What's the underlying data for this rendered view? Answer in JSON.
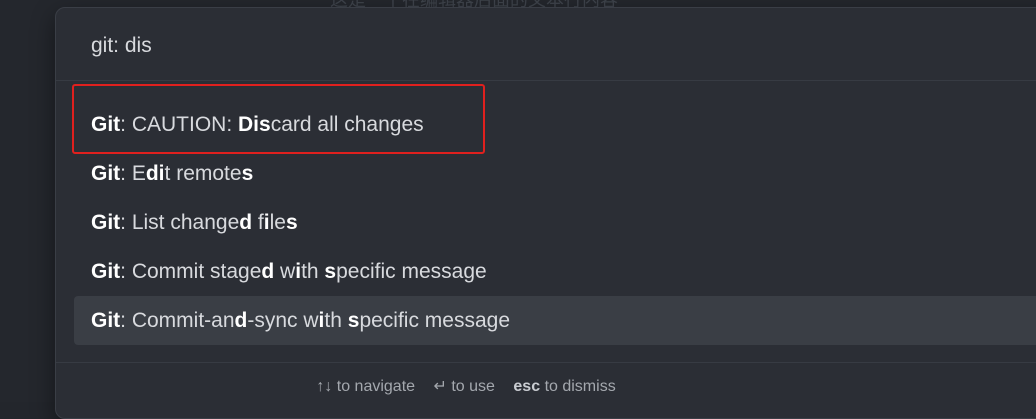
{
  "background": {
    "ghost_text": "这是一个在编辑器后面的文本行内容"
  },
  "search": {
    "value": "git: dis",
    "placeholder": ""
  },
  "results": [
    {
      "segments": [
        {
          "t": "Git",
          "b": true
        },
        {
          "t": ": CAUTION: ",
          "b": false
        },
        {
          "t": "Dis",
          "b": true
        },
        {
          "t": "card all changes",
          "b": false
        }
      ]
    },
    {
      "segments": [
        {
          "t": "Git",
          "b": true
        },
        {
          "t": ": E",
          "b": false
        },
        {
          "t": "di",
          "b": true
        },
        {
          "t": "t remote",
          "b": false
        },
        {
          "t": "s",
          "b": true
        }
      ]
    },
    {
      "segments": [
        {
          "t": "Git",
          "b": true
        },
        {
          "t": ": List change",
          "b": false
        },
        {
          "t": "d",
          "b": true
        },
        {
          "t": " f",
          "b": false
        },
        {
          "t": "i",
          "b": true
        },
        {
          "t": "le",
          "b": false
        },
        {
          "t": "s",
          "b": true
        }
      ]
    },
    {
      "segments": [
        {
          "t": "Git",
          "b": true
        },
        {
          "t": ": Commit stage",
          "b": false
        },
        {
          "t": "d",
          "b": true
        },
        {
          "t": " w",
          "b": false
        },
        {
          "t": "i",
          "b": true
        },
        {
          "t": "th ",
          "b": false
        },
        {
          "t": "s",
          "b": true
        },
        {
          "t": "pecific message",
          "b": false
        }
      ]
    },
    {
      "segments": [
        {
          "t": "Git",
          "b": true
        },
        {
          "t": ": Commit-an",
          "b": false
        },
        {
          "t": "d",
          "b": true
        },
        {
          "t": "-sync w",
          "b": false
        },
        {
          "t": "i",
          "b": true
        },
        {
          "t": "th ",
          "b": false
        },
        {
          "t": "s",
          "b": true
        },
        {
          "t": "pecific message",
          "b": false
        }
      ]
    }
  ],
  "active_index": 4,
  "footer": {
    "navigate_glyph": "↑↓",
    "navigate_text": "to navigate",
    "use_glyph": "↵",
    "use_text": "to use",
    "dismiss_key": "esc",
    "dismiss_text": "to dismiss"
  },
  "colors": {
    "annotation_red": "#e0201e"
  }
}
